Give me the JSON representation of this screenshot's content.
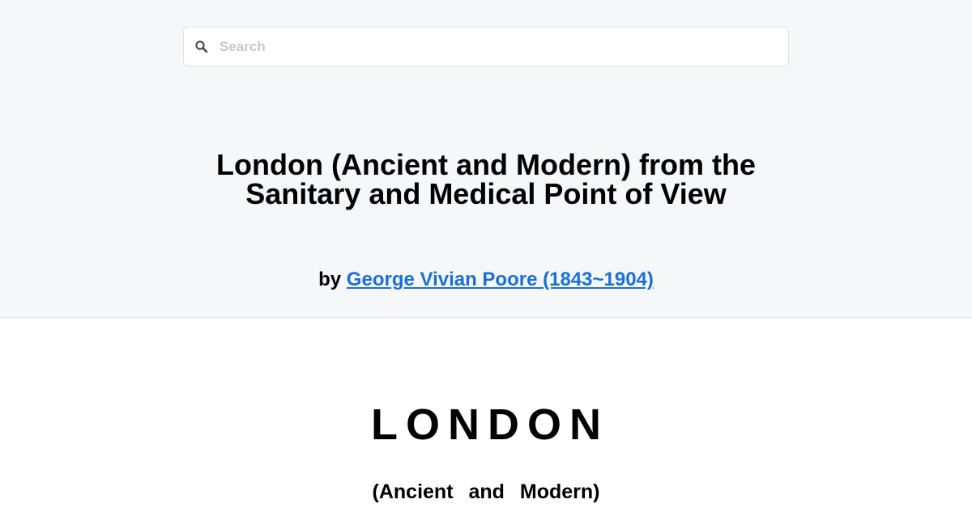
{
  "search": {
    "placeholder": "Search",
    "value": "",
    "icon": "search-icon"
  },
  "book": {
    "title": "London (Ancient and Modern) from the Sanitary and Medical Point of View",
    "by_prefix": "by",
    "author": "George Vivian Poore (1843~1904)"
  },
  "content": {
    "heading": "LONDON",
    "subheading": "(Ancient and Modern)"
  },
  "colors": {
    "header_background": "#f6f7f9",
    "link": "#1a6fd8",
    "page_background": "#ffffff"
  }
}
